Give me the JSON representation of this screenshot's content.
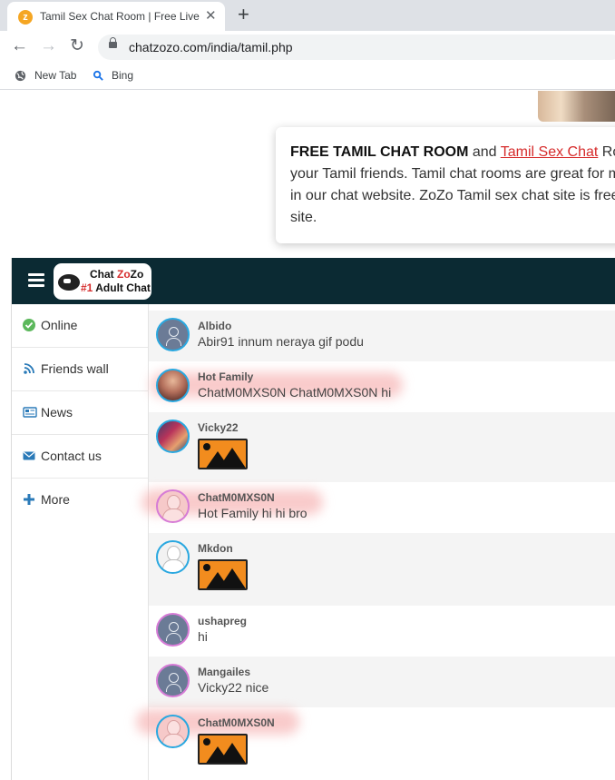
{
  "browser": {
    "tab_title": "Tamil Sex Chat Room | Free Live T",
    "tab_favicon": "chatzozo-favicon",
    "url": "chatzozo.com/india/tamil.php",
    "bookmarks": [
      {
        "label": "New Tab",
        "icon": "globe-icon"
      },
      {
        "label": "Bing",
        "icon": "search-icon"
      }
    ]
  },
  "info_card": {
    "line1_bold": "FREE TAMIL CHAT ROOM",
    "line1_and": " and ",
    "line1_link": "Tamil Sex Chat",
    "line1_rest": " Roo",
    "line2": "your Tamil friends. Tamil chat rooms are great for m",
    "line3": "in our chat website. ZoZo Tamil sex chat site is free",
    "line4": "site."
  },
  "chat": {
    "logo": {
      "line1_a": "Chat ",
      "line1_b": "Zo",
      "line1_c": "Zo",
      "line2_a": "#1",
      "line2_b": " Adult Chat"
    },
    "sidebar": [
      {
        "label": "Online",
        "icon": "check-circle-icon"
      },
      {
        "label": "Friends wall",
        "icon": "rss-icon"
      },
      {
        "label": "News",
        "icon": "newspaper-icon"
      },
      {
        "label": "Contact us",
        "icon": "envelope-icon"
      },
      {
        "label": "More",
        "icon": "plus-icon"
      }
    ],
    "posts": [
      {
        "user": "Albido",
        "message": "Abir91 innum neraya gif podu"
      },
      {
        "user": "Hot Family",
        "message": "ChatM0MXS0N ChatM0MXS0N hi"
      },
      {
        "user": "Vicky22",
        "message": ""
      },
      {
        "user": "ChatM0MXS0N",
        "message": "Hot Family hi hi bro"
      },
      {
        "user": "Mkdon",
        "message": ""
      },
      {
        "user": "ushapreg",
        "message": "hi"
      },
      {
        "user": "Mangailes",
        "message": "Vicky22 nice"
      },
      {
        "user": "ChatM0MXS0N",
        "message": ""
      }
    ]
  },
  "colors": {
    "header_bg": "#0b2a33",
    "accent_red": "#d62c2c",
    "online_green": "#5cb85c",
    "link_blue": "#2a7ab8"
  }
}
